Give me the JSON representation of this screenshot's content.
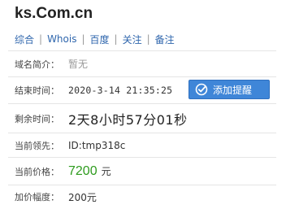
{
  "domain": {
    "name": "ks.Com.cn"
  },
  "links": [
    {
      "label": "综合"
    },
    {
      "label": "Whois"
    },
    {
      "label": "百度"
    },
    {
      "label": "关注"
    },
    {
      "label": "备注"
    }
  ],
  "link_separator": "|",
  "info": {
    "intro_label": "域名简介：",
    "intro_value": "暂无",
    "end_label": "结束时间：",
    "end_value": "2020-3-14 21:35:25",
    "remind_button_label": "添加提醒",
    "remain_label": "剩余时间：",
    "remain_value": "2天8小时57分01秒",
    "leader_label": "当前领先：",
    "leader_value": "ID:tmp318c",
    "price_label": "当前价格：",
    "price_value": "7200",
    "price_unit": "元",
    "increment_label": "加价幅度：",
    "increment_value": "200元"
  },
  "colors": {
    "link": "#2f66ad",
    "price": "#2e9b1e",
    "button_bg": "#3f86d8",
    "muted": "#9a9a9a"
  },
  "icons": {
    "remind_button": "check-circle-icon"
  }
}
